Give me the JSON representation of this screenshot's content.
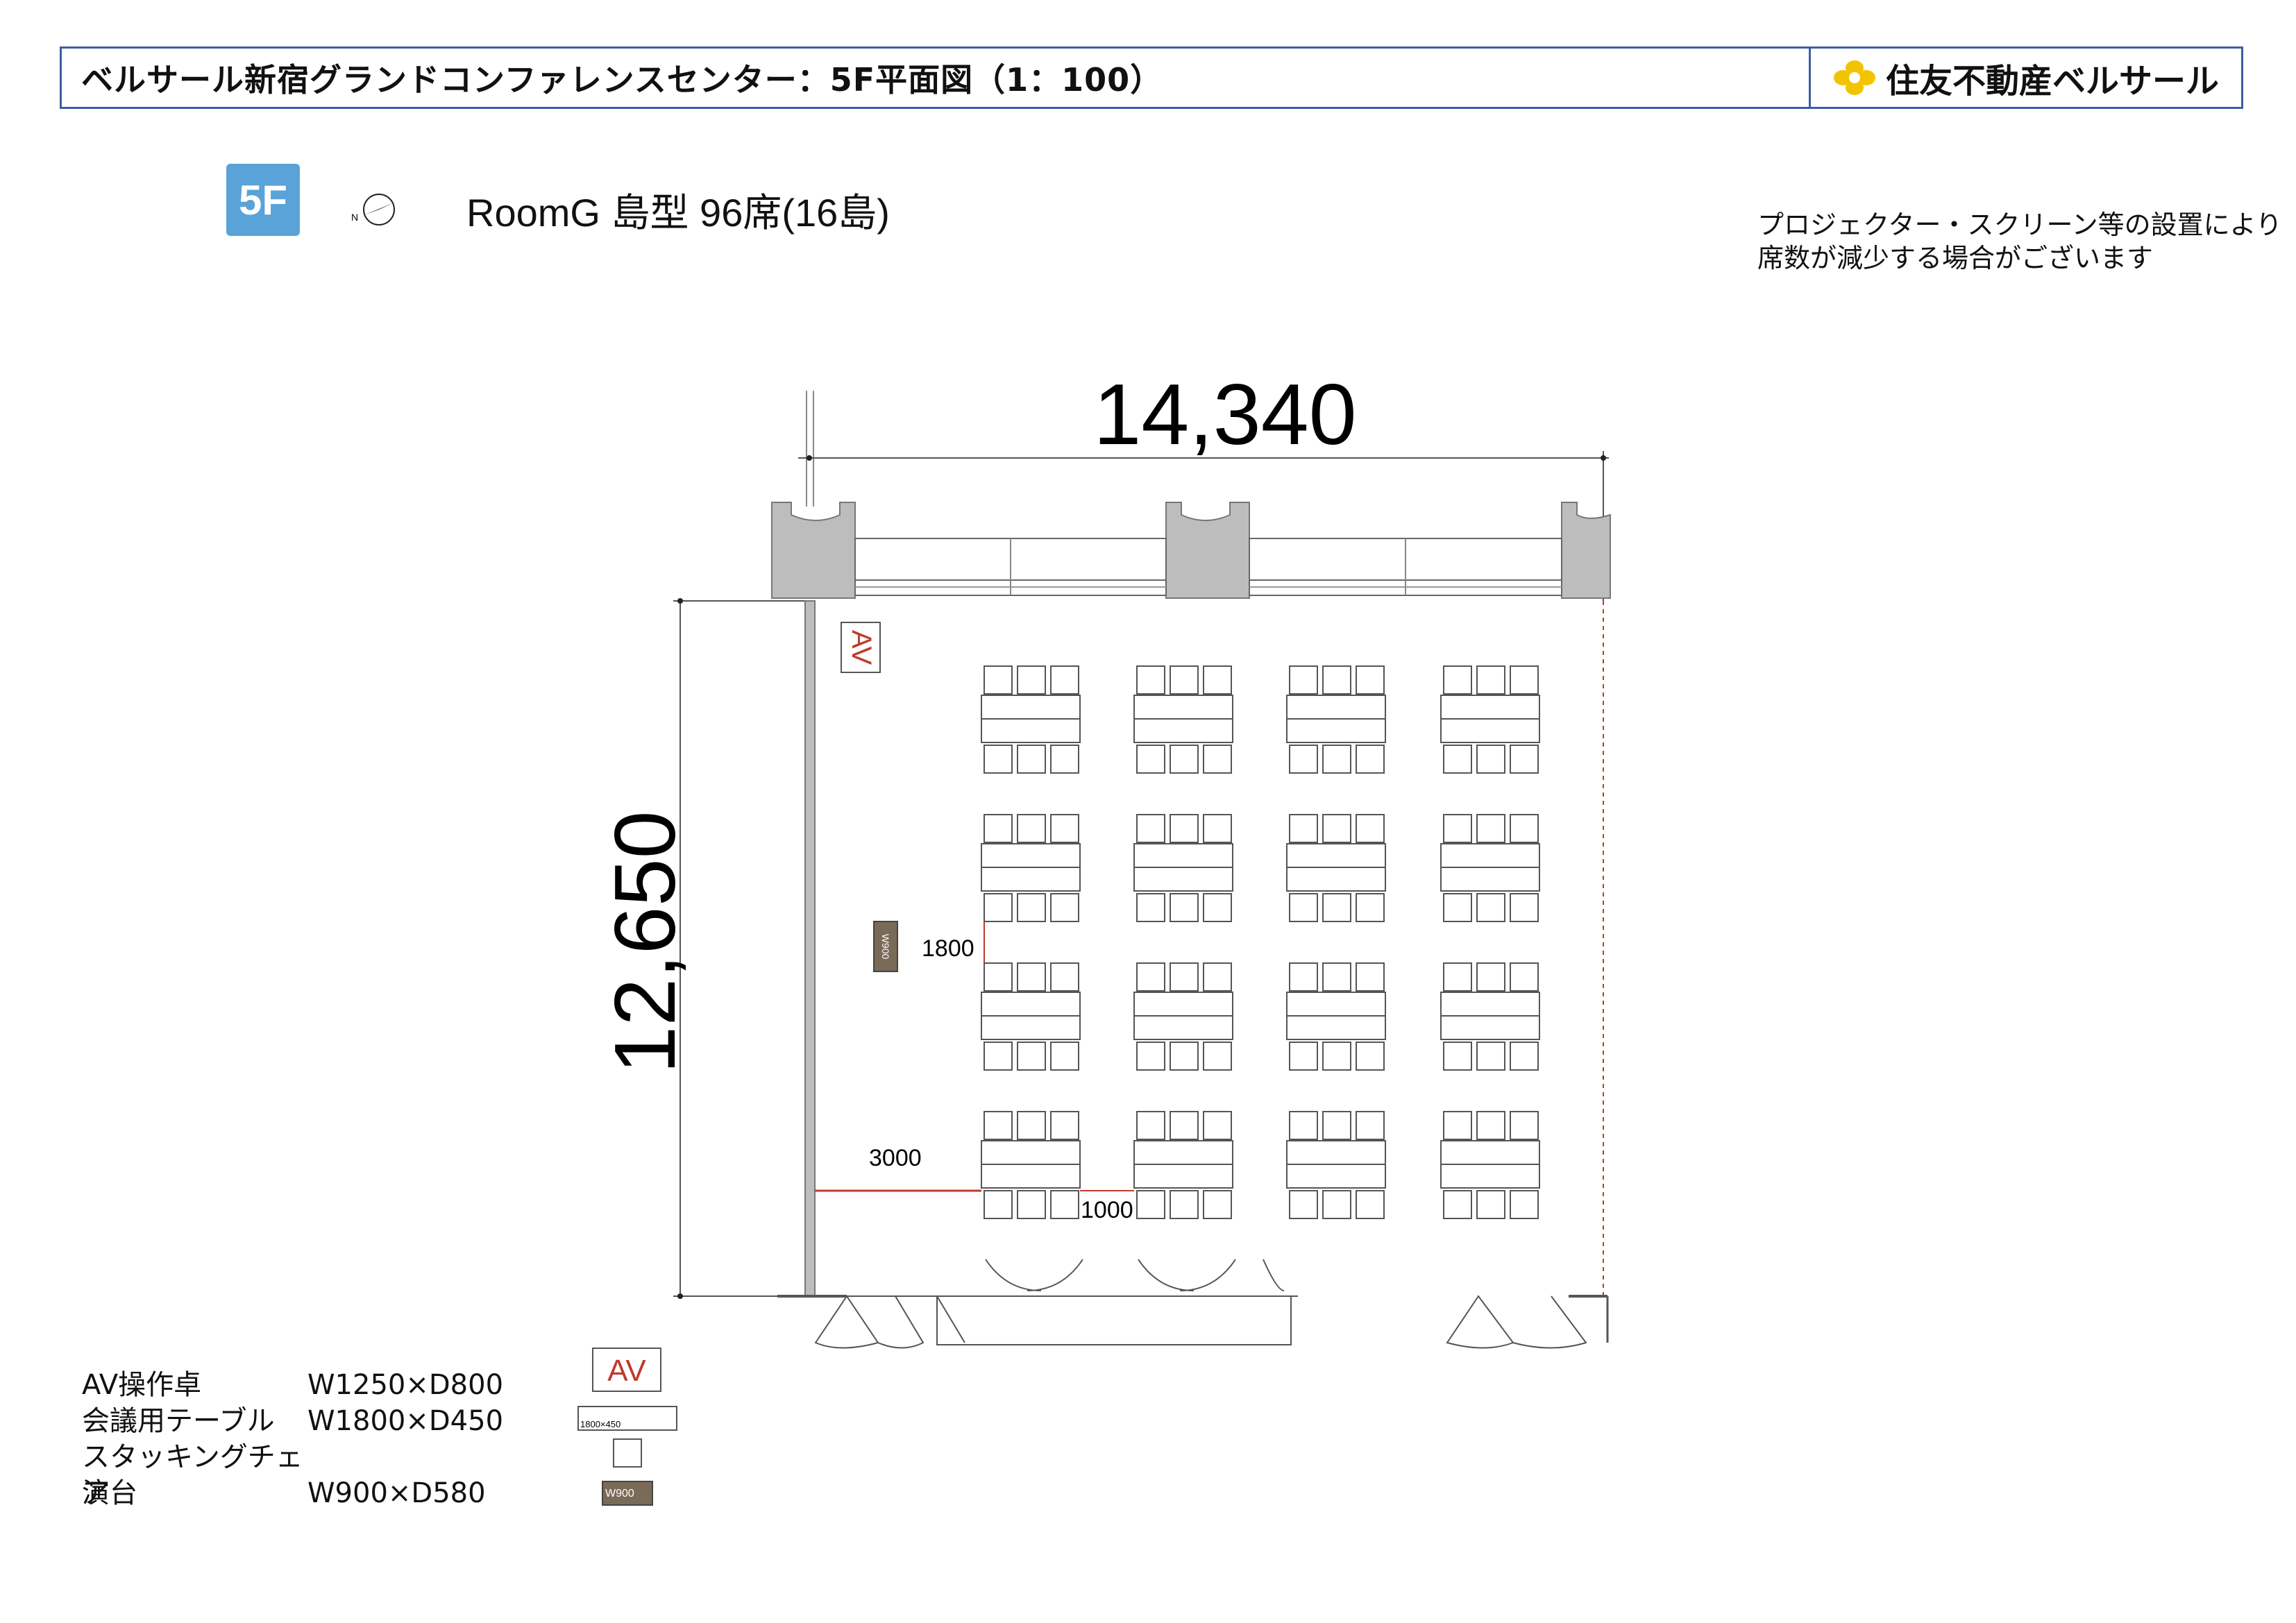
{
  "header": {
    "title": "ベルサール新宿グランドコンファレンスセンター：5F平面図（1：100）",
    "brand": "住友不動産ベルサール"
  },
  "floor_badge": "5F",
  "compass_label": "N",
  "room_title": "RoomG 島型 96席(16島)",
  "notice": {
    "line1": "プロジェクター・スクリーン等の設置により",
    "line2": "席数が減少する場合がございます"
  },
  "plan": {
    "width_dim": "14,340",
    "height_dim": "12,650",
    "av_label": "AV",
    "podium_label": "W900",
    "dim_1800": "1800",
    "dim_3000": "3000",
    "dim_1000": "1000",
    "accent_color": "#c0392b",
    "wall_color": "#bdbdbd"
  },
  "legend": {
    "av_name": "AV操作卓",
    "av_dim": "W1250×D800",
    "av_symbol": "AV",
    "table_name": "会議用テーブル",
    "table_dim": "W1800×D450",
    "table_symbol": "1800×450",
    "chair_name": "スタッキングチェア",
    "chair_dim": "",
    "podium_name": "演台",
    "podium_dim": "W900×D580",
    "podium_symbol": "W900"
  }
}
